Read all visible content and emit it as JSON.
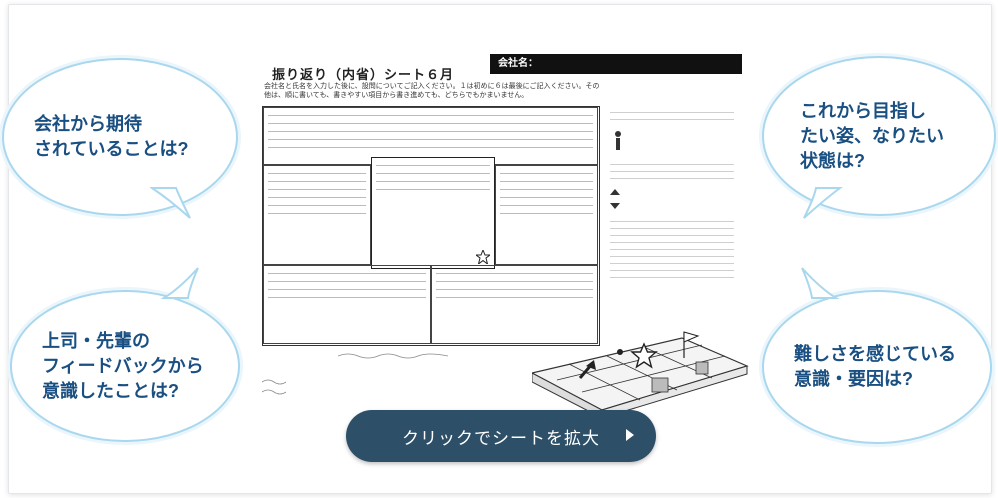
{
  "sheet": {
    "title": "振り返り（内省）シート６月",
    "company_label": "会社名：",
    "instructions": "会社名と氏名を入力した後に、設問についてご記入ください。１は初めに６は最後にご記入ください。その他は、順に書いても、書きやすい項目から書き進めても、どちらでもかまいません。"
  },
  "bubbles": {
    "top_left": [
      "会社から期待",
      "されていることは?"
    ],
    "bottom_left": [
      "上司・先輩の",
      "フィードバックから",
      "意識したことは?"
    ],
    "top_right": [
      "これから目指し",
      "たい姿、なりたい",
      "状態は?"
    ],
    "bottom_right": [
      "難しさを感じている",
      "意識・要因は?"
    ]
  },
  "cta": {
    "label": "クリックでシートを拡大",
    "arrow_icon": "play-triangle-icon"
  },
  "colors": {
    "bubble_text": "#1a4f82",
    "bubble_border": "#a9d7ee",
    "cta_bg": "#2e4f68"
  }
}
